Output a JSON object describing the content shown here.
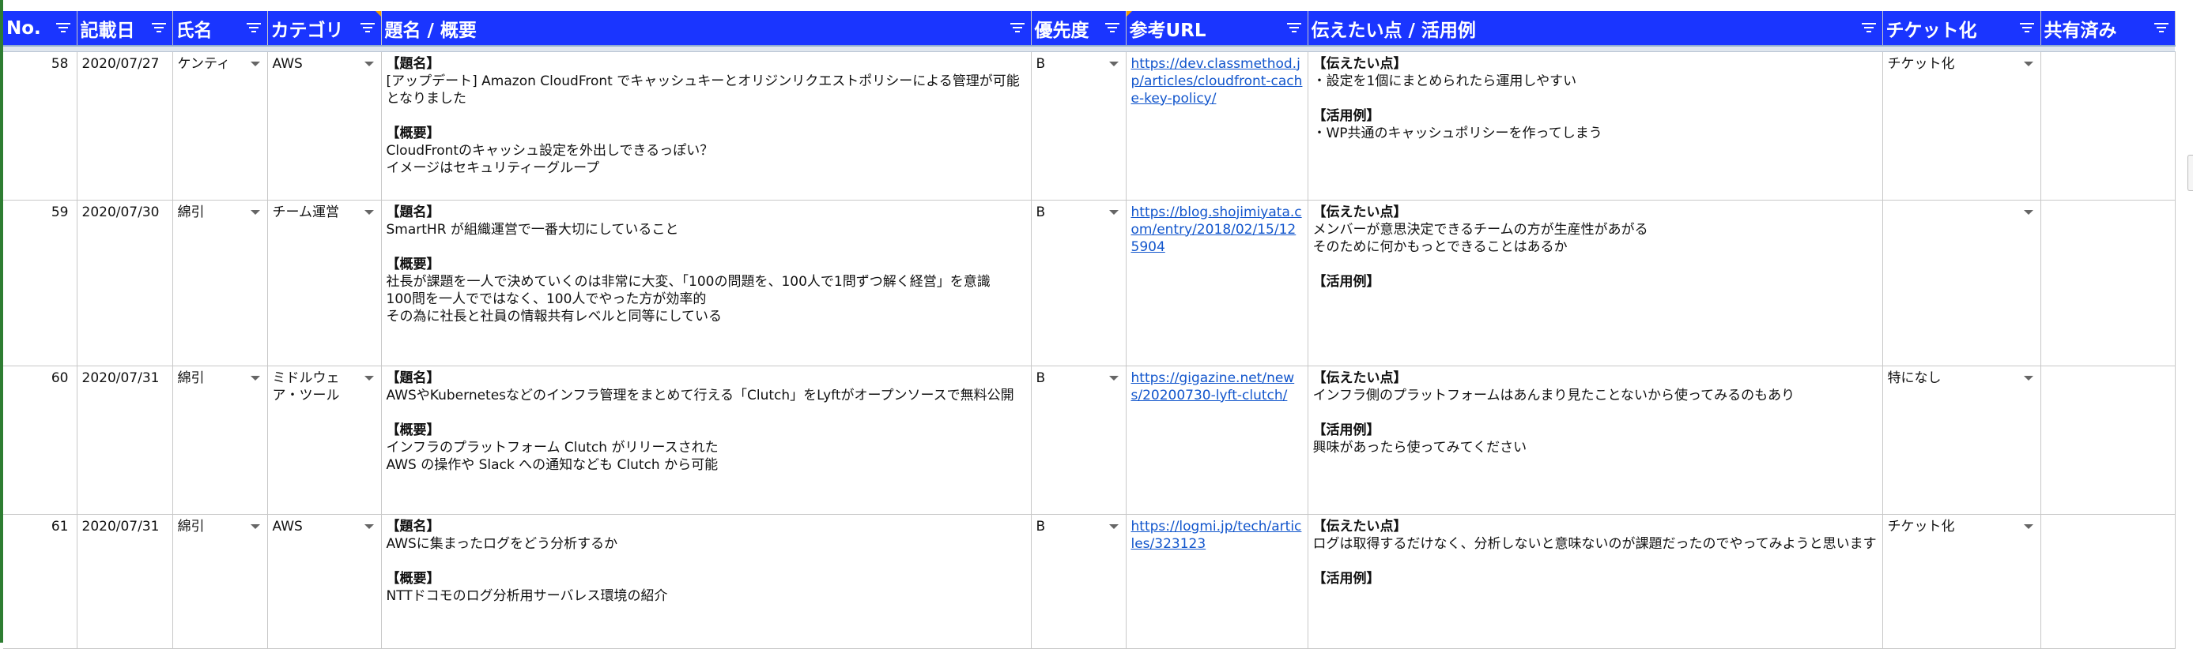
{
  "headers": {
    "no": "No.",
    "date": "記載日",
    "name": "氏名",
    "category": "カテゴリ",
    "title": "題名 / 概要",
    "priority": "優先度",
    "url": "参考URL",
    "points": "伝えたい点 / 活用例",
    "ticket": "チケット化",
    "shared": "共有済み"
  },
  "rows": [
    {
      "no": "58",
      "date": "2020/07/27",
      "name": "ケンティ",
      "category": "AWS",
      "title_label": "【題名】",
      "title_text": "[アップデート] Amazon CloudFront でキャッシュキーとオリジンリクエストポリシーによる管理が可能となりました",
      "summary_label": "【概要】",
      "summary_text": "CloudFrontのキャッシュ設定を外出しできるっぽい？\nイメージはセキュリティーグループ",
      "priority": "B",
      "url": "https://dev.classmethod.jp/articles/cloudfront-cache-key-policy/",
      "points_label": "【伝えたい点】",
      "points_text": "・設定を1個にまとめられたら運用しやすい",
      "usage_label": "【活用例】",
      "usage_text": "・WP共通のキャッシュポリシーを作ってしまう",
      "ticket": "チケット化",
      "shared": ""
    },
    {
      "no": "59",
      "date": "2020/07/30",
      "name": "綿引",
      "category": "チーム運営",
      "title_label": "【題名】",
      "title_text": "SmartHR が組織運営で一番大切にしていること",
      "summary_label": "【概要】",
      "summary_text": "社長が課題を一人で決めていくのは非常に大変、「100の問題を、100人で1問ずつ解く経営」を意識\n100問を一人でではなく、100人でやった方が効率的\nその為に社長と社員の情報共有レベルと同等にしている",
      "priority": "B",
      "url": "https://blog.shojimiyata.com/entry/2018/02/15/125904",
      "points_label": "【伝えたい点】",
      "points_text": "メンバーが意思決定できるチームの方が生産性があがる\nそのために何かもっとできることはあるか",
      "usage_label": "【活用例】",
      "usage_text": "",
      "ticket": "",
      "shared": ""
    },
    {
      "no": "60",
      "date": "2020/07/31",
      "name": "綿引",
      "category": "ミドルウェア・ツール",
      "title_label": "【題名】",
      "title_text": "AWSやKubernetesなどのインフラ管理をまとめて行える「Clutch」をLyftがオープンソースで無料公開",
      "summary_label": "【概要】",
      "summary_text": "インフラのプラットフォーム Clutch がリリースされた\nAWS の操作や Slack への通知なども Clutch から可能",
      "priority": "B",
      "url": "https://gigazine.net/news/20200730-lyft-clutch/",
      "points_label": "【伝えたい点】",
      "points_text": "インフラ側のプラットフォームはあんまり見たことないから使ってみるのもあり",
      "usage_label": "【活用例】",
      "usage_text": "興味があったら使ってみてください",
      "ticket": "特になし",
      "shared": ""
    },
    {
      "no": "61",
      "date": "2020/07/31",
      "name": "綿引",
      "category": "AWS",
      "title_label": "【題名】",
      "title_text": "AWSに集まったログをどう分析するか",
      "summary_label": "【概要】",
      "summary_text": "NTTドコモのログ分析用サーバレス環境の紹介",
      "priority": "B",
      "url": "https://logmi.jp/tech/articles/323123",
      "points_label": "【伝えたい点】",
      "points_text": "ログは取得するだけなく、分析しないと意味ないのが課題だったのでやってみようと思います",
      "usage_label": "【活用例】",
      "usage_text": "",
      "ticket": "チケット化",
      "shared": ""
    }
  ]
}
